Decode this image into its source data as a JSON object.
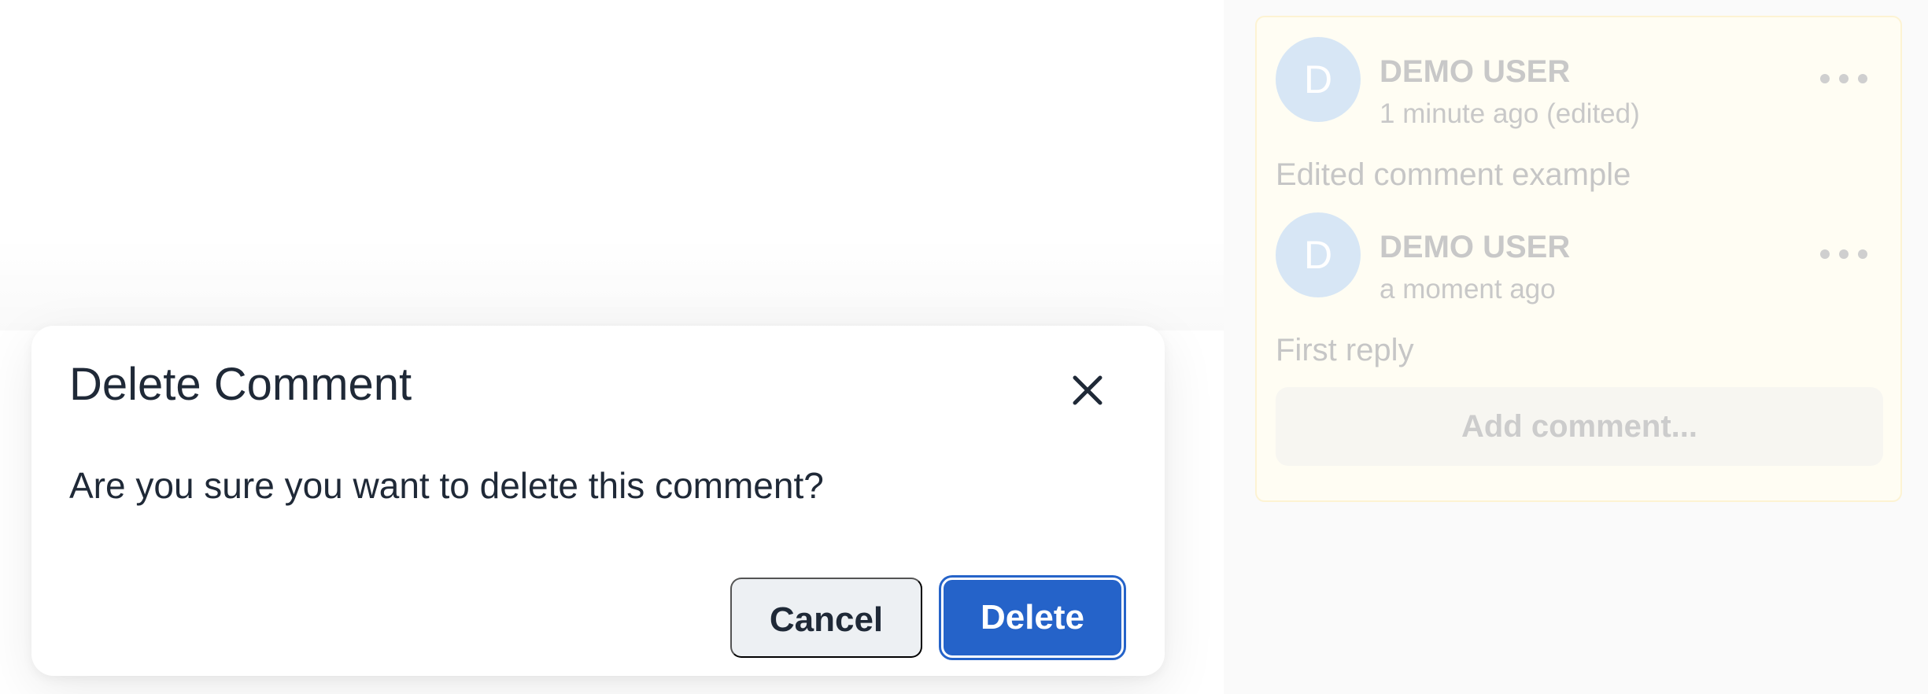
{
  "dialog": {
    "title": "Delete Comment",
    "message": "Are you sure you want to delete this comment?",
    "close_icon": "close-icon",
    "cancel_label": "Cancel",
    "delete_label": "Delete",
    "delete_color": "#2563c9"
  },
  "sidebar": {
    "thread_background": "#fffdf3",
    "comments": [
      {
        "avatar_initial": "D",
        "author": "DEMO USER",
        "timestamp": "1 minute ago (edited)",
        "body": "Edited comment example",
        "menu_icon": "more-horizontal-icon"
      },
      {
        "avatar_initial": "D",
        "author": "DEMO USER",
        "timestamp": "a moment ago",
        "body": "First reply",
        "menu_icon": "more-horizontal-icon"
      }
    ],
    "add_comment_label": "Add comment..."
  }
}
